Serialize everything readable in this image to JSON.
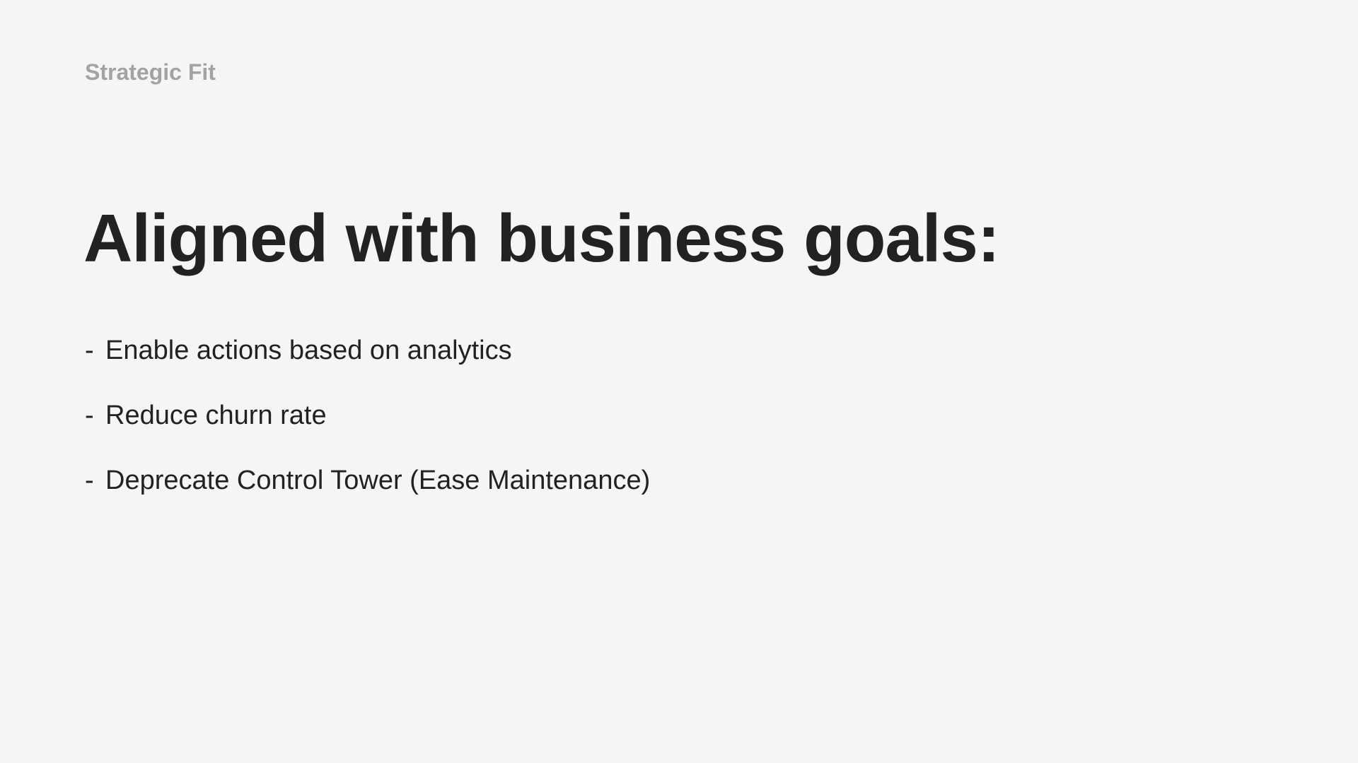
{
  "slide": {
    "eyebrow": "Strategic Fit",
    "headline": "Aligned with business goals:",
    "goals": [
      {
        "marker": "-",
        "text": "Enable actions based on analytics"
      },
      {
        "marker": "-",
        "text": "Reduce churn rate"
      },
      {
        "marker": "-",
        "text": "Deprecate Control Tower (Ease Maintenance)"
      }
    ]
  },
  "colors": {
    "background": "#f5f5f5",
    "eyebrow": "#a3a3a3",
    "text": "#222222"
  }
}
